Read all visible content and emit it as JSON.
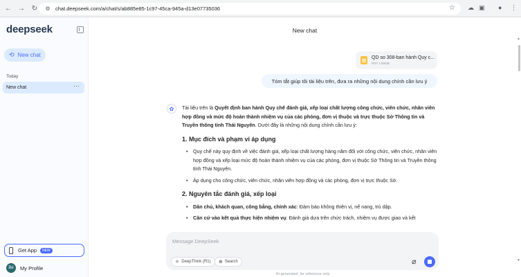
{
  "browser": {
    "back": "←",
    "forward": "→",
    "reload": "↻",
    "url": "chat.deepseek.com/a/chat/s/ab885e85-1c97-45ca-945a-d13e07735036"
  },
  "sidebar": {
    "logo": "deepseek",
    "new_chat": "New chat",
    "section_today": "Today",
    "conversations": [
      {
        "label": "New chat"
      }
    ],
    "get_app": "Get App",
    "new_badge": "NEW",
    "profile_initials": "Bé",
    "profile_label": "My Profile"
  },
  "main": {
    "title": "New chat",
    "file": {
      "name": "QD so 308-ban hành Quy c...",
      "meta": "PDF 1.88MB"
    },
    "user_message": "Tóm tắt giúp tôi tài liệu trên, đưa ra những nội dung chính cần lưu ý",
    "answer": {
      "intro_prefix": "Tài liệu trên là ",
      "intro_bold": "Quyết định ban hành Quy chế đánh giá, xếp loại chất lượng công chức, viên chức, nhân viên hợp đồng và mức độ hoàn thành nhiệm vụ của các phòng, đơn vị thuộc và trực thuộc Sở Thông tin và Truyền thông tỉnh Thái Nguyên",
      "intro_suffix": ". Dưới đây là những nội dung chính cần lưu ý:",
      "section1_title": "1. Mục đích và phạm vi áp dụng",
      "section1_items": [
        "Quy chế này quy định về việc đánh giá, xếp loại chất lượng hàng năm đối với công chức, viên chức, nhân viên hợp đồng và xếp loại mức độ hoàn thành nhiệm vụ của các phòng, đơn vị thuộc Sở Thông tin và Truyền thông tỉnh Thái Nguyên.",
        "Áp dụng cho công chức, viên chức, nhân viên hợp đồng và các phòng, đơn vị trực thuộc Sở."
      ],
      "section2_title": "2. Nguyên tắc đánh giá, xếp loại",
      "section2_items": [
        {
          "bold": "Dân chủ, khách quan, công bằng, chính xác",
          "text": ": Đảm bảo không thiên vị, nể nang, trù dập."
        },
        {
          "bold": "Căn cứ vào kết quả thực hiện nhiệm vụ",
          "text": ": Đánh giá dựa trên chức trách, nhiệm vụ được giao và kết"
        }
      ]
    },
    "input_placeholder": "Message DeepSeek",
    "deepthink_label": "DeepThink (R1)",
    "search_label": "Search",
    "footer_note": "AI-generated, for reference only"
  },
  "colors": {
    "accent": "#4d6bfe",
    "sidebar_bg": "#f9fbff",
    "selected_bg": "#dbeafe",
    "user_bubble": "#eff6ff"
  }
}
